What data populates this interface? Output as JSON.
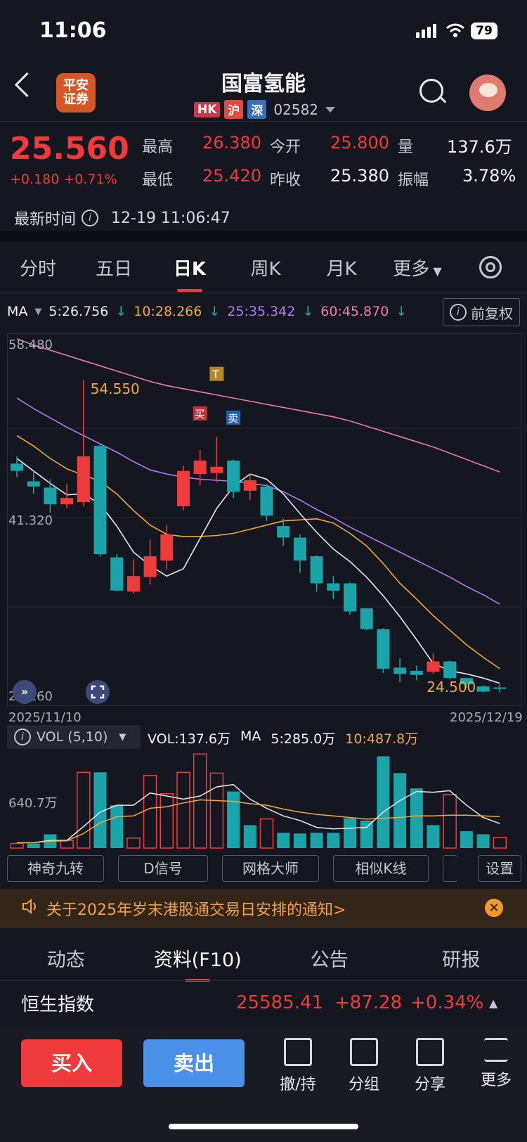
{
  "status_bar": {
    "time": "11:06",
    "battery": "79"
  },
  "header": {
    "logo_line1": "平安",
    "logo_line2": "证券",
    "title": "国富氢能",
    "tags": [
      "HK",
      "沪",
      "深"
    ],
    "code": "02582"
  },
  "quote": {
    "price": "25.560",
    "change": "+0.180 +0.71%",
    "high_label": "最高",
    "high": "26.380",
    "open_label": "今开",
    "open": "25.800",
    "volume_label": "量",
    "volume": "137.6万",
    "low_label": "最低",
    "low": "25.420",
    "prev_close_label": "昨收",
    "prev_close": "25.380",
    "amplitude_label": "振幅",
    "amplitude": "3.78%",
    "latest_time_label": "最新时间",
    "latest_time": "12-19 11:06:47"
  },
  "tabs": [
    "分时",
    "五日",
    "日K",
    "周K",
    "月K",
    "更多"
  ],
  "active_tab": "日K",
  "ma_legend": {
    "label": "MA",
    "ma5": "5:26.756",
    "ma10": "10:28.266",
    "ma25": "25:35.342",
    "ma60": "60:45.870",
    "adjust": "前复权",
    "colors": {
      "ma5": "#e8e8e8",
      "ma10": "#f2a93b",
      "ma25": "#b07cf0",
      "ma60": "#f07ab0"
    }
  },
  "chart_data": [
    {
      "type": "candlestick",
      "y_axis_labels": [
        "58.480",
        "41.320",
        "24.160"
      ],
      "ylim": [
        24.16,
        58.48
      ],
      "x_start_label": "2025/11/10",
      "x_end_label": "2025/12/19",
      "max_annotation": "54.550",
      "min_annotation": "24.500",
      "markers": {
        "buy": "买",
        "sell": "卖",
        "t": "T"
      },
      "up_color": "#ef3b3b",
      "down_color": "#1aa3a8",
      "candles": [
        {
          "o": 46.5,
          "c": 45.8,
          "h": 47.2,
          "l": 45.2
        },
        {
          "o": 44.8,
          "c": 44.3,
          "h": 45.8,
          "l": 43.6
        },
        {
          "o": 44.2,
          "c": 42.6,
          "h": 45.0,
          "l": 41.8
        },
        {
          "o": 42.6,
          "c": 43.2,
          "h": 44.6,
          "l": 42.2
        },
        {
          "o": 42.8,
          "c": 47.2,
          "h": 54.55,
          "l": 42.4
        },
        {
          "o": 48.2,
          "c": 37.8,
          "h": 48.4,
          "l": 37.6
        },
        {
          "o": 37.5,
          "c": 34.3,
          "h": 37.8,
          "l": 34.2
        },
        {
          "o": 34.2,
          "c": 35.7,
          "h": 37.3,
          "l": 34.0
        },
        {
          "o": 35.6,
          "c": 37.6,
          "h": 39.2,
          "l": 34.9
        },
        {
          "o": 37.2,
          "c": 39.7,
          "h": 40.6,
          "l": 36.3
        },
        {
          "o": 42.4,
          "c": 45.8,
          "h": 46.3,
          "l": 42.0
        },
        {
          "o": 45.5,
          "c": 46.8,
          "h": 47.8,
          "l": 44.4
        },
        {
          "o": 45.6,
          "c": 46.2,
          "h": 49.1,
          "l": 44.7
        },
        {
          "o": 46.8,
          "c": 43.8,
          "h": 46.9,
          "l": 43.2
        },
        {
          "o": 43.9,
          "c": 44.9,
          "h": 45.5,
          "l": 43.0
        },
        {
          "o": 44.3,
          "c": 41.5,
          "h": 44.5,
          "l": 41.0
        },
        {
          "o": 40.5,
          "c": 39.4,
          "h": 41.2,
          "l": 38.6
        },
        {
          "o": 39.4,
          "c": 37.2,
          "h": 39.7,
          "l": 36.0
        },
        {
          "o": 37.6,
          "c": 35.0,
          "h": 37.7,
          "l": 34.2
        },
        {
          "o": 35.0,
          "c": 34.3,
          "h": 35.7,
          "l": 33.5
        },
        {
          "o": 35.0,
          "c": 32.3,
          "h": 35.1,
          "l": 32.0
        },
        {
          "o": 32.6,
          "c": 30.6,
          "h": 32.6,
          "l": 30.5
        },
        {
          "o": 30.6,
          "c": 26.8,
          "h": 30.7,
          "l": 26.4
        },
        {
          "o": 26.9,
          "c": 26.3,
          "h": 27.8,
          "l": 25.5
        },
        {
          "o": 26.6,
          "c": 26.2,
          "h": 27.1,
          "l": 25.7
        },
        {
          "o": 26.5,
          "c": 27.5,
          "h": 28.3,
          "l": 26.3
        },
        {
          "o": 27.5,
          "c": 25.9,
          "h": 27.6,
          "l": 25.8
        },
        {
          "o": 25.9,
          "c": 25.3,
          "h": 25.9,
          "l": 24.9
        },
        {
          "o": 25.1,
          "c": 24.6,
          "h": 25.2,
          "l": 24.5
        },
        {
          "o": 25.0,
          "c": 24.9,
          "h": 25.3,
          "l": 24.5
        }
      ],
      "ma5": [
        47.0,
        45.8,
        44.6,
        43.5,
        43.6,
        42.6,
        40.5,
        38.0,
        36.7,
        35.7,
        36.4,
        39.3,
        42.2,
        44.3,
        45.5,
        45.0,
        43.6,
        41.7,
        39.9,
        38.3,
        37.1,
        35.6,
        33.8,
        31.8,
        29.6,
        27.3,
        26.6,
        26.3,
        25.9,
        25.4
      ],
      "ma10": [
        49.2,
        48.2,
        47.0,
        46.0,
        45.4,
        44.8,
        43.6,
        42.0,
        40.6,
        39.7,
        39.5,
        39.5,
        39.6,
        39.8,
        40.2,
        40.6,
        41.0,
        41.1,
        41.2,
        40.8,
        39.8,
        38.6,
        36.9,
        35.0,
        33.5,
        31.9,
        30.5,
        29.1,
        27.9,
        26.8
      ],
      "ma25": [
        52.8,
        51.8,
        50.9,
        50.0,
        49.2,
        48.4,
        47.6,
        46.7,
        45.9,
        45.5,
        45.2,
        45.0,
        44.9,
        44.8,
        44.6,
        44.4,
        43.8,
        43.0,
        42.1,
        41.3,
        40.4,
        39.6,
        38.8,
        38.0,
        37.2,
        36.4,
        35.6,
        34.7,
        33.9,
        33.0
      ],
      "ma60": [
        58.5,
        57.9,
        57.4,
        56.9,
        56.4,
        55.9,
        55.4,
        54.9,
        54.4,
        54.0,
        53.7,
        53.4,
        53.1,
        52.8,
        52.5,
        52.2,
        51.9,
        51.6,
        51.3,
        51.0,
        50.6,
        50.1,
        49.6,
        49.1,
        48.6,
        48.1,
        47.5,
        46.9,
        46.3,
        45.7
      ]
    },
    {
      "type": "bar",
      "title": "VOL (5,10)",
      "vol_label": "VOL:137.6万",
      "ma_label": "MA",
      "ma5_label": "5:285.0万",
      "ma10_label": "10:487.8万",
      "y_axis_label": "640.7万",
      "ylim": [
        0,
        1250
      ],
      "values": [
        60,
        60,
        180,
        100,
        990,
        990,
        560,
        130,
        950,
        710,
        990,
        1230,
        980,
        740,
        300,
        380,
        200,
        190,
        200,
        200,
        390,
        360,
        1200,
        980,
        780,
        300,
        700,
        220,
        180,
        140
      ],
      "direction": [
        "up",
        "down",
        "down",
        "up",
        "up",
        "down",
        "down",
        "up",
        "up",
        "up",
        "up",
        "up",
        "up",
        "down",
        "down",
        "up",
        "down",
        "down",
        "down",
        "down",
        "down",
        "down",
        "down",
        "down",
        "down",
        "down",
        "up",
        "down",
        "down",
        "up"
      ],
      "ma5": [
        70,
        72,
        100,
        100,
        280,
        470,
        560,
        560,
        720,
        680,
        640,
        680,
        800,
        830,
        640,
        520,
        420,
        360,
        270,
        250,
        260,
        270,
        470,
        620,
        740,
        730,
        750,
        560,
        400,
        320
      ],
      "ma10": [
        70,
        70,
        90,
        95,
        190,
        330,
        410,
        420,
        520,
        540,
        590,
        630,
        620,
        610,
        580,
        560,
        510,
        470,
        440,
        420,
        400,
        380,
        390,
        400,
        420,
        420,
        430,
        430,
        420,
        410
      ]
    }
  ],
  "chips": [
    "神奇九转",
    "D信号",
    "网格大师",
    "相似K线",
    "设置"
  ],
  "notice": "关于2025年岁末港股通交易日安排的通知>",
  "sub_tabs": [
    "动态",
    "资料(F10)",
    "公告",
    "研报"
  ],
  "index": {
    "name": "恒生指数",
    "value": "25585.41",
    "change": "+87.28",
    "pct": "+0.34%"
  },
  "bottom": {
    "buy": "买入",
    "sell": "卖出",
    "actions": [
      "撤/持",
      "分组",
      "分享",
      "更多"
    ]
  }
}
